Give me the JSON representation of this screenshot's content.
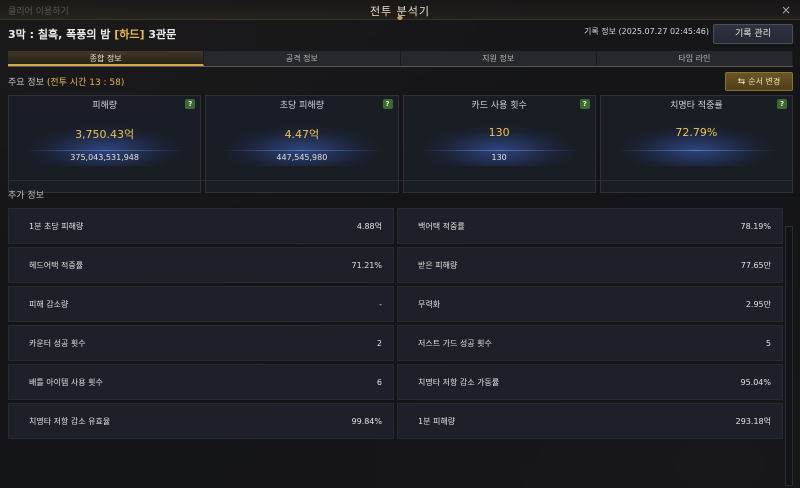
{
  "window": {
    "title": "전투 분석기",
    "ghost_text": "클리어 이용하기",
    "close_symbol": "×"
  },
  "header": {
    "stage_prefix": "3막 : 칠흑, 폭풍의 밤",
    "difficulty": "[하드]",
    "stage_suffix": "3관문",
    "record_info": "기록 정보 (2025.07.27 02:45:46)",
    "record_button": "기록 관리"
  },
  "tabs": [
    {
      "label": "종합 정보",
      "active": true
    },
    {
      "label": "공격 정보",
      "active": false
    },
    {
      "label": "지원 정보",
      "active": false
    },
    {
      "label": "타임 라인",
      "active": false
    }
  ],
  "main_info": {
    "label": "주요 정보",
    "battle_time": "(전투 시간 13 : 58)",
    "order_button": "순서 변경",
    "order_icon": "⇆"
  },
  "stat_cards": [
    {
      "title": "피해량",
      "main": "3,750.43억",
      "sub": "375,043,531,948",
      "help": "?"
    },
    {
      "title": "초당 피해량",
      "main": "4.47억",
      "sub": "447,545,980",
      "help": "?"
    },
    {
      "title": "카드 사용 횟수",
      "main": "130",
      "sub": "130",
      "help": "?"
    },
    {
      "title": "치명타 적중률",
      "main": "72.79%",
      "sub": "",
      "help": "?"
    }
  ],
  "extra_info": {
    "label": "추가 정보",
    "rows": [
      {
        "label": "1분 초당 피해량",
        "value": "4.88억"
      },
      {
        "label": "백어택 적중률",
        "value": "78.19%"
      },
      {
        "label": "헤드어택 적중률",
        "value": "71.21%"
      },
      {
        "label": "받은 피해량",
        "value": "77.65만"
      },
      {
        "label": "피해 감소량",
        "value": "-"
      },
      {
        "label": "무력화",
        "value": "2.95만"
      },
      {
        "label": "카운터 성공 횟수",
        "value": "2"
      },
      {
        "label": "저스트 가드 성공 횟수",
        "value": "5"
      },
      {
        "label": "배틀 아이템 사용 횟수",
        "value": "6"
      },
      {
        "label": "치명타 저항 감소 가동률",
        "value": "95.04%"
      },
      {
        "label": "치명타 저항 감소 유효율",
        "value": "99.84%"
      },
      {
        "label": "1분 피해량",
        "value": "293.18억"
      }
    ]
  },
  "colors": {
    "accent_gold": "#e5b94a",
    "help_green": "#3d6b2f"
  }
}
